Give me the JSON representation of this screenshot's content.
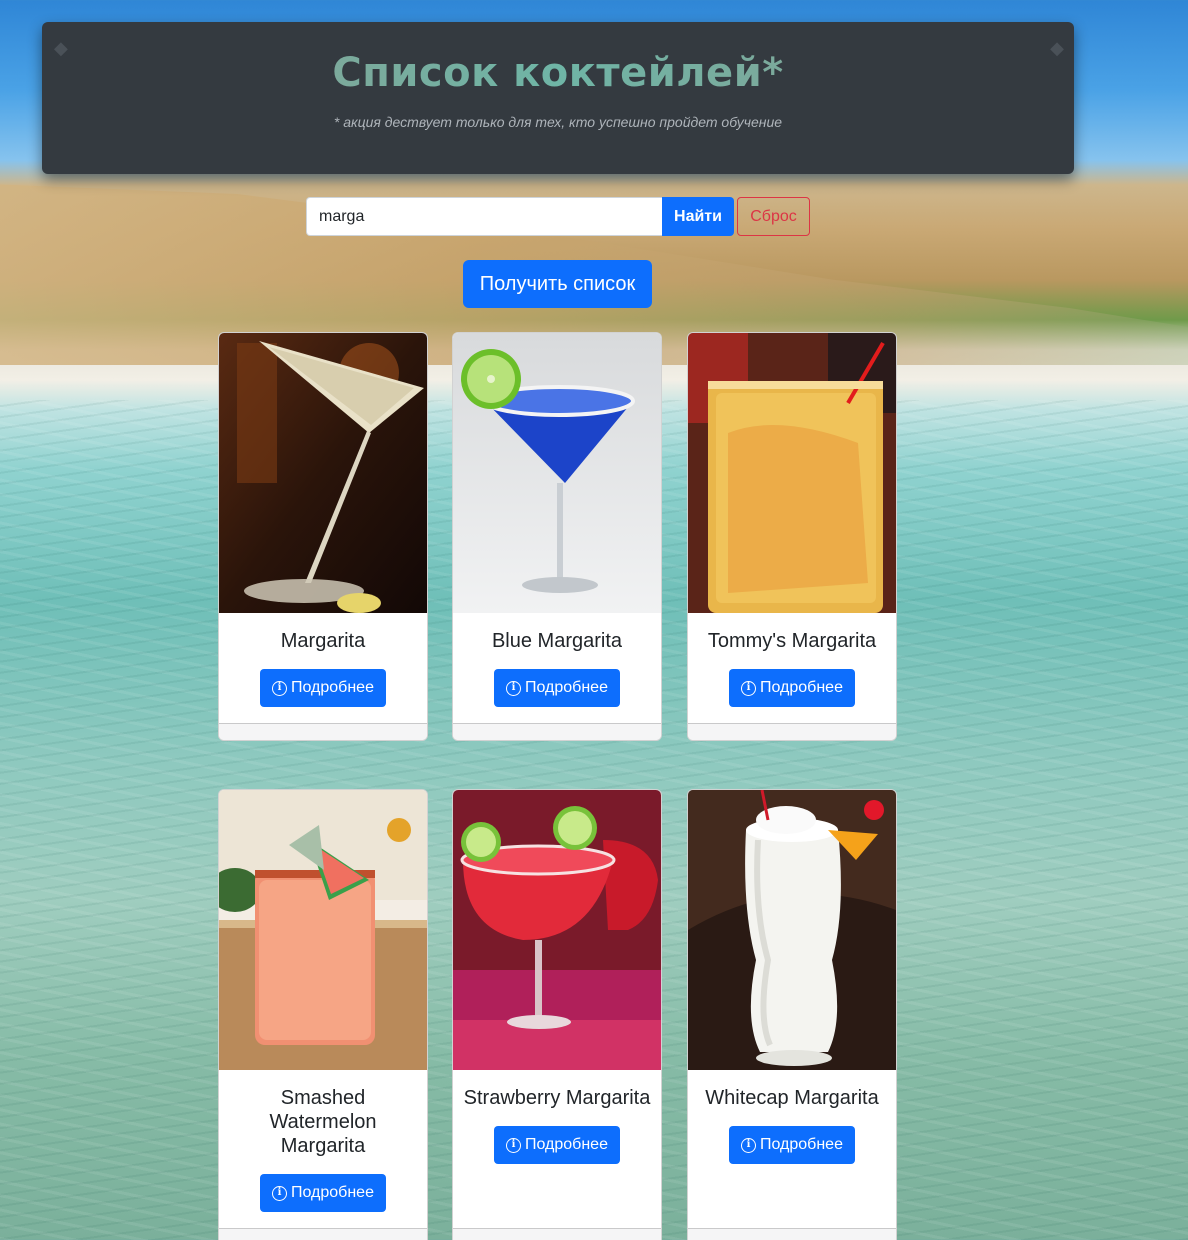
{
  "header": {
    "title": "Список коктейлей*",
    "note": "* акция дествует только для тех, кто успешно пройдет обучение"
  },
  "search": {
    "value": "marga",
    "find_label": "Найти",
    "reset_label": "Сброс"
  },
  "get_list_label": "Получить список",
  "colors": {
    "primary": "#0d6efd",
    "danger": "#dc3545",
    "header_bg": "#343a40"
  },
  "cards": [
    {
      "title": "Margarita",
      "button": "Подробнее",
      "icon": "info-icon"
    },
    {
      "title": "Blue Margarita",
      "button": "Подробнее",
      "icon": "info-icon"
    },
    {
      "title": "Tommy's Margarita",
      "button": "Подробнее",
      "icon": "info-icon"
    },
    {
      "title": "Smashed Watermelon Margarita",
      "button": "Подробнее",
      "icon": "info-icon"
    },
    {
      "title": "Strawberry Margarita",
      "button": "Подробнее",
      "icon": "info-icon"
    },
    {
      "title": "Whitecap Margarita",
      "button": "Подробнее",
      "icon": "info-icon"
    }
  ]
}
